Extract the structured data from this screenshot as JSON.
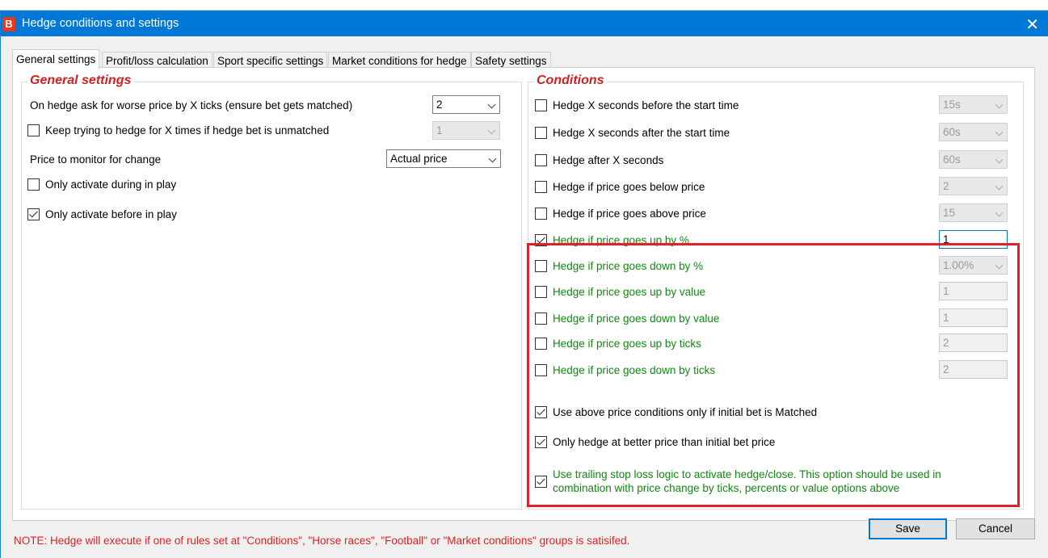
{
  "window": {
    "title": "Hedge conditions and settings",
    "app_icon_letter": "B",
    "close_glyph": "✕"
  },
  "tabs": [
    {
      "label": "General settings",
      "active": true
    },
    {
      "label": "Profit/loss calculation"
    },
    {
      "label": "Sport specific settings"
    },
    {
      "label": "Market conditions for hedge"
    },
    {
      "label": "Safety settings"
    }
  ],
  "general": {
    "title": "General settings",
    "worse_price_label": "On hedge ask for worse price by X ticks (ensure bet gets matched)",
    "worse_price_value": "2",
    "keep_trying_label": "Keep trying to hedge for X times if hedge bet is unmatched",
    "keep_trying_value": "1",
    "keep_trying_checked": false,
    "price_monitor_label": "Price to monitor for change",
    "price_monitor_value": "Actual price",
    "during_inplay_label": "Only activate during in play",
    "during_inplay_checked": false,
    "before_inplay_label": "Only activate before in play",
    "before_inplay_checked": true
  },
  "conditions": {
    "title": "Conditions",
    "items": [
      {
        "label": "Hedge X seconds before the start time",
        "checked": false,
        "value": "15s",
        "control": "dropdown",
        "green": false
      },
      {
        "label": "Hedge X seconds after the start time",
        "checked": false,
        "value": "60s",
        "control": "dropdown",
        "green": false
      },
      {
        "label": "Hedge after X seconds",
        "checked": false,
        "value": "60s",
        "control": "dropdown",
        "green": false
      },
      {
        "label": "Hedge if price goes below price",
        "checked": false,
        "value": "2",
        "control": "dropdown",
        "green": false
      },
      {
        "label": "Hedge if price goes above price",
        "checked": false,
        "value": "15",
        "control": "dropdown",
        "green": false
      },
      {
        "label": "Hedge if price goes up by %",
        "checked": true,
        "value": "1",
        "control": "text-active",
        "green": true
      },
      {
        "label": "Hedge if price goes down by %",
        "checked": false,
        "value": "1.00%",
        "control": "dropdown",
        "green": true
      },
      {
        "label": "Hedge if price goes up by value",
        "checked": false,
        "value": "1",
        "control": "text",
        "green": true
      },
      {
        "label": "Hedge if price goes down by value",
        "checked": false,
        "value": "1",
        "control": "text",
        "green": true
      },
      {
        "label": "Hedge if price goes up by ticks",
        "checked": false,
        "value": "2",
        "control": "text",
        "green": true
      },
      {
        "label": "Hedge if price goes down by ticks",
        "checked": false,
        "value": "2",
        "control": "text",
        "green": true
      }
    ],
    "use_above_label": "Use above price conditions only if initial bet is Matched",
    "use_above_checked": true,
    "better_price_label": "Only hedge at better price than initial bet price",
    "better_price_checked": true,
    "trailing_label": "Use trailing stop loss logic to activate hedge/close. This option should be used in combination with price change by ticks, percents or value options above",
    "trailing_checked": true
  },
  "footer": {
    "note": "NOTE: Hedge will execute if one of rules set at \"Conditions\", \"Horse races\", \"Football\" or \"Market conditions\" groups is satisifed.",
    "save_label": "Save",
    "cancel_label": "Cancel"
  },
  "colors": {
    "titlebar": "#0078d7",
    "group_title": "#d12020",
    "green_text": "#118811",
    "highlight_box": "#e0202a",
    "note": "#e02020"
  }
}
